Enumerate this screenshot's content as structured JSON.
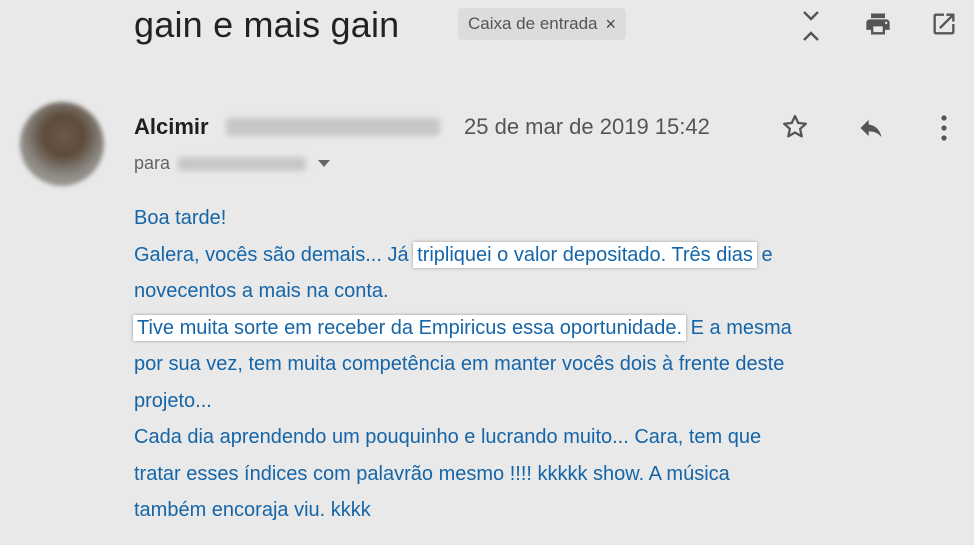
{
  "header": {
    "subject": "gain e mais gain",
    "label": "Caixa de entrada",
    "label_remove": "×"
  },
  "message": {
    "sender_name": "Alcimir",
    "date": "25 de mar de 2019 15:42",
    "to_prefix": "para"
  },
  "body": {
    "line1": "Boa tarde!",
    "line2_a": "Galera, vocês são demais... Já ",
    "line2_hl": "tripliquei o valor depositado. Três dias",
    "line2_b": " e",
    "line3": "novecentos a mais na conta.",
    "line4_hl": "Tive muita sorte em receber da Empiricus essa oportunidade.",
    "line4_b": " E a mesma",
    "line5": "por sua vez, tem muita competência em manter vocês dois à frente deste",
    "line6": "projeto...",
    "line7": "Cada dia aprendendo um pouquinho e lucrando muito... Cara, tem que",
    "line8": "tratar esses índices com palavrão mesmo !!!! kkkkk show. A música",
    "line9": "também encoraja viu. kkkk"
  },
  "colors": {
    "body_text": "#1565a8",
    "background": "#e9e9e9"
  }
}
